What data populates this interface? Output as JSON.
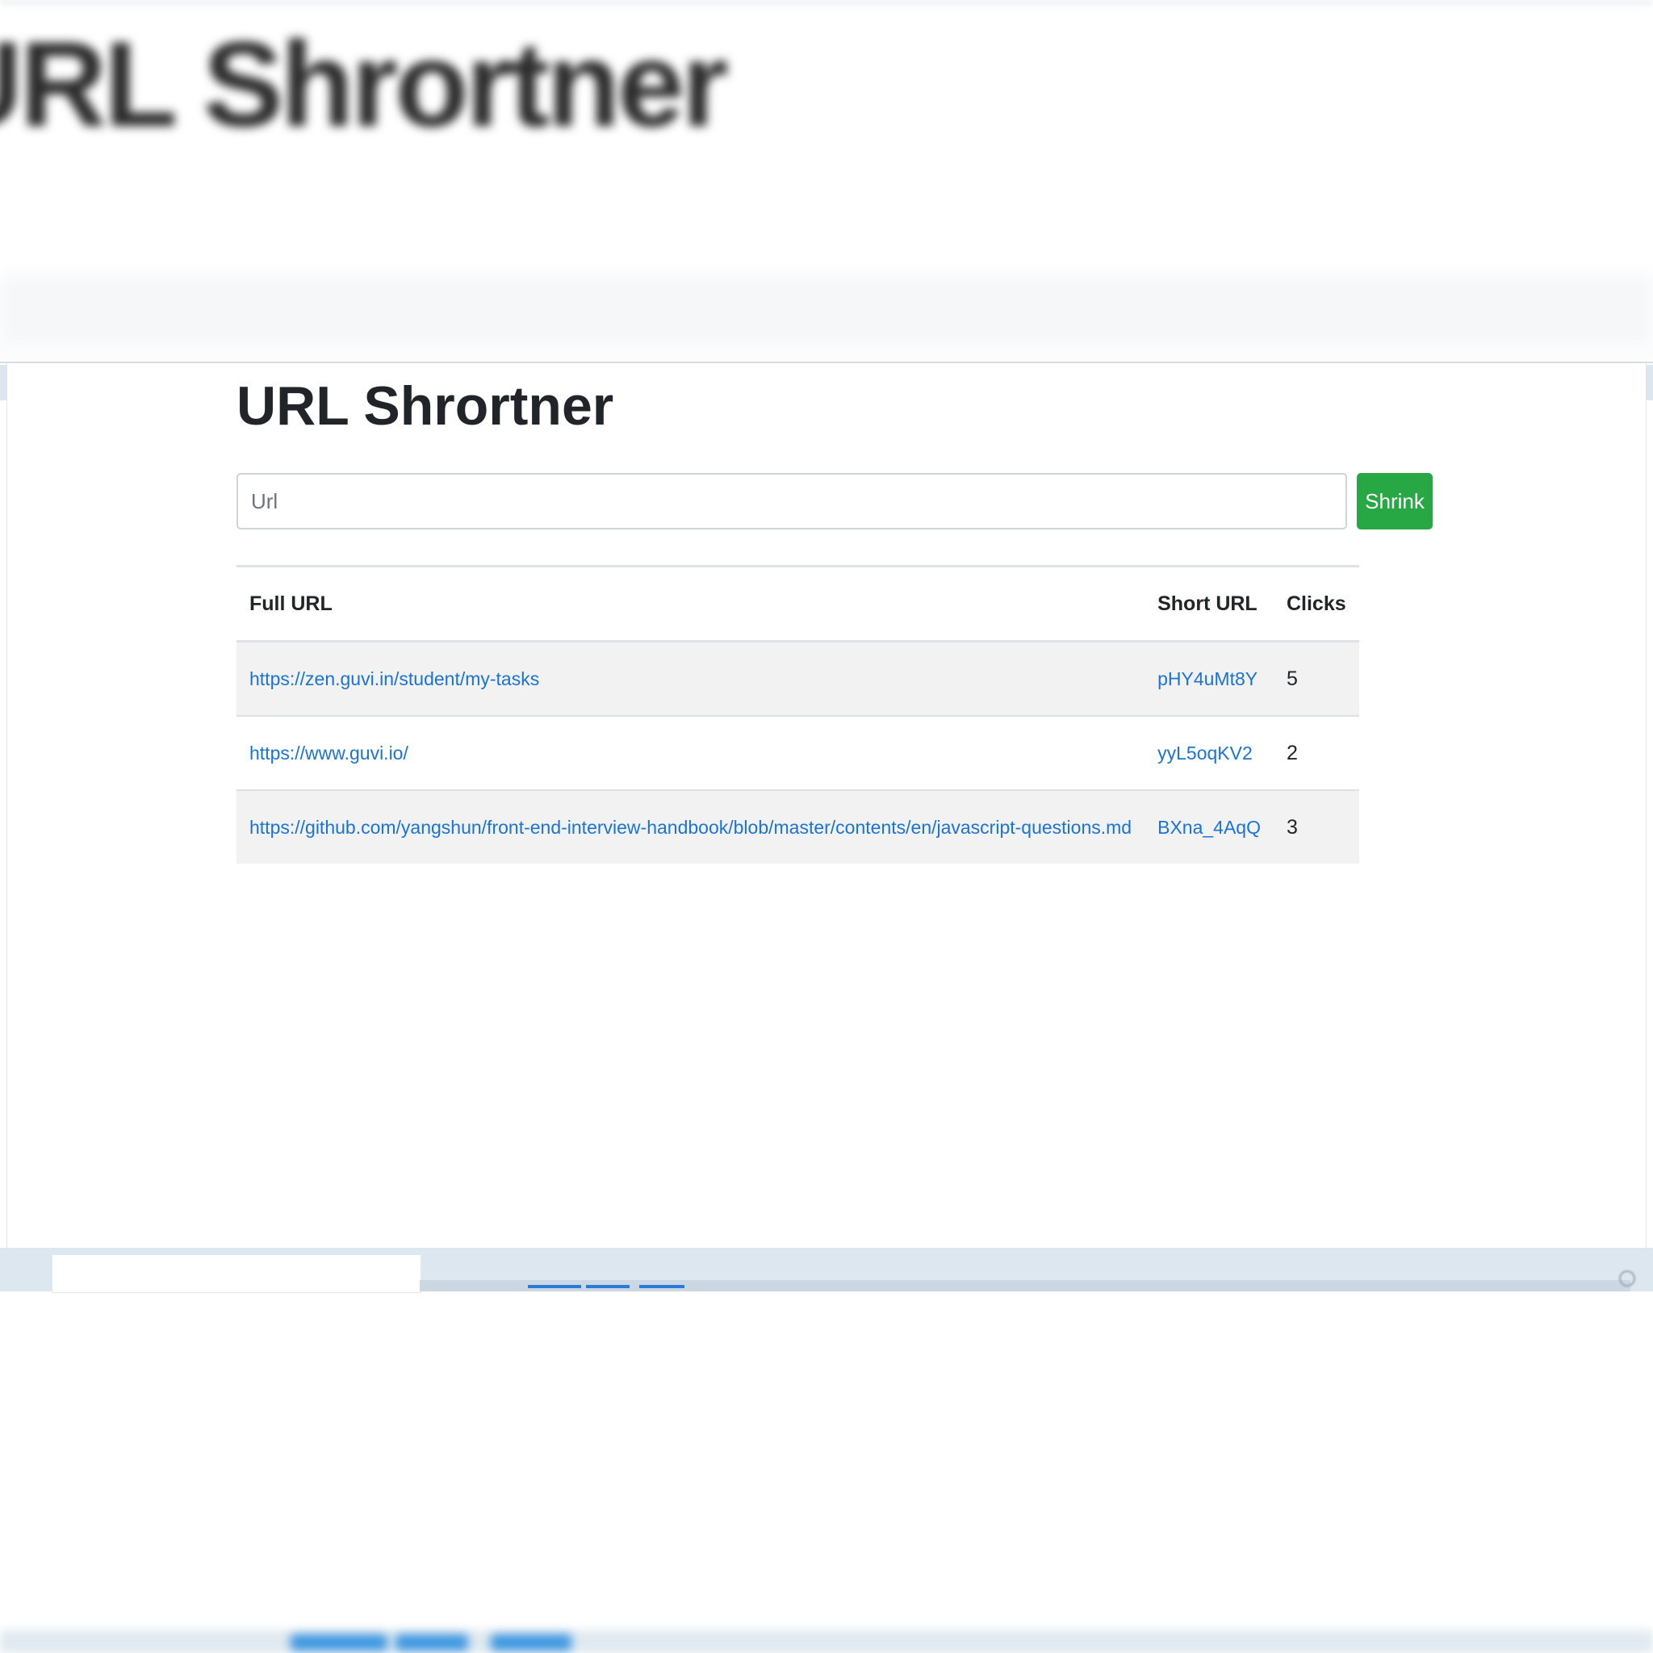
{
  "page": {
    "title": "URL Shrortner"
  },
  "background": {
    "zoomed_title": "URL Shrortner"
  },
  "form": {
    "url_placeholder": "Url",
    "url_value": "",
    "submit_label": "Shrink"
  },
  "table": {
    "headers": {
      "full_url": "Full URL",
      "short_url": "Short URL",
      "clicks": "Clicks"
    },
    "rows": [
      {
        "full_url": "https://zen.guvi.in/student/my-tasks",
        "short_url": "pHY4uMt8Y",
        "clicks": "5"
      },
      {
        "full_url": "https://www.guvi.io/",
        "short_url": "yyL5oqKV2",
        "clicks": "2"
      },
      {
        "full_url": "https://github.com/yangshun/front-end-interview-handbook/blob/master/contents/en/javascript-questions.md",
        "short_url": "BXna_4AqQ",
        "clicks": "3"
      }
    ]
  },
  "colors": {
    "accent_button": "#28a745",
    "link": "#1a73d9",
    "stripe": "#f2f2f2",
    "text": "#212529"
  }
}
